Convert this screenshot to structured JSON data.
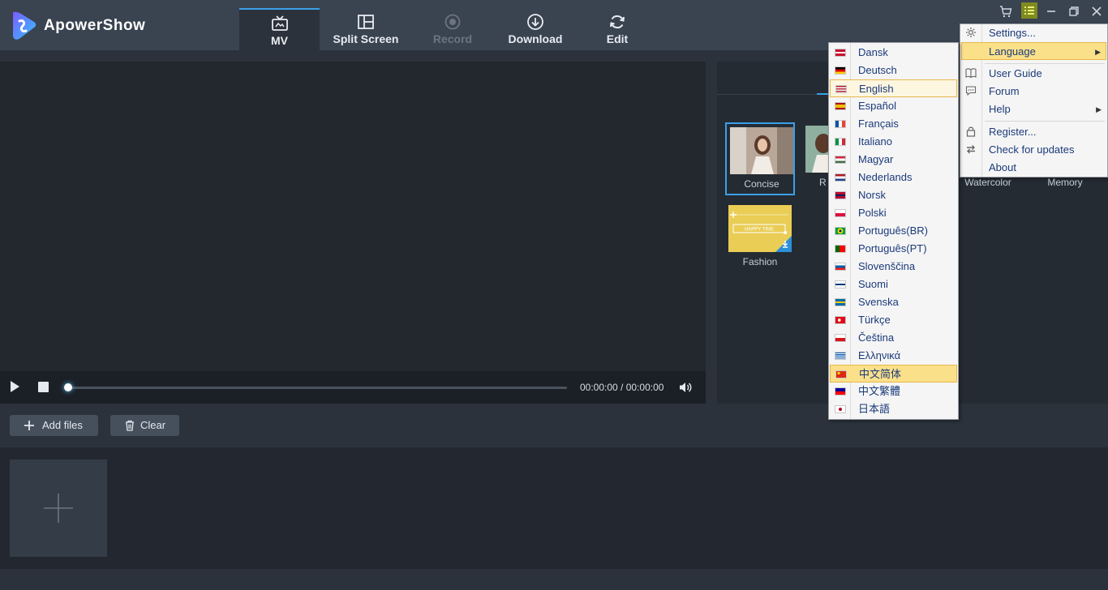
{
  "app": {
    "title": "ApowerShow",
    "logo_colors": [
      "#7b5cff",
      "#35c1ff"
    ]
  },
  "tabs": [
    {
      "label": "MV",
      "icon": "tv-icon",
      "active": true
    },
    {
      "label": "Split Screen",
      "icon": "split-screen-icon"
    },
    {
      "label": "Record",
      "icon": "record-icon",
      "disabled": true
    },
    {
      "label": "Download",
      "icon": "download-icon"
    },
    {
      "label": "Edit",
      "icon": "refresh-icon"
    }
  ],
  "window_controls": {
    "cart": "cart-icon",
    "menu": "menu-icon",
    "minimize": "minimize-icon",
    "restore": "restore-icon",
    "close": "close-icon"
  },
  "player": {
    "time": "00:00:00 / 00:00:00",
    "progress": 0
  },
  "themes": [
    {
      "label": "Concise",
      "selected": true
    },
    {
      "label": "R"
    },
    {
      "label": "Watercolor"
    },
    {
      "label": "Memory"
    },
    {
      "label": "Fashion",
      "thumb_text": "HAPPY TIME"
    }
  ],
  "toolbar": {
    "add_files": "Add files",
    "clear": "Clear"
  },
  "main_menu": {
    "items": [
      {
        "label": "Settings...",
        "icon": "gear-icon"
      },
      {
        "label": "Language",
        "submenu": true,
        "highlighted": true
      },
      {
        "label": "User Guide",
        "icon": "book-icon"
      },
      {
        "label": "Forum",
        "icon": "chat-icon"
      },
      {
        "label": "Help",
        "submenu": true
      },
      {
        "label": "Register...",
        "icon": "lock-icon"
      },
      {
        "label": "Check for updates",
        "icon": "update-icon"
      },
      {
        "label": "About"
      }
    ]
  },
  "language_menu": {
    "items": [
      {
        "label": "Dansk",
        "flag": "dk"
      },
      {
        "label": "Deutsch",
        "flag": "de"
      },
      {
        "label": "English",
        "flag": "us",
        "selected": true
      },
      {
        "label": "Español",
        "flag": "es"
      },
      {
        "label": "Français",
        "flag": "fr"
      },
      {
        "label": "Italiano",
        "flag": "it"
      },
      {
        "label": "Magyar",
        "flag": "hu"
      },
      {
        "label": "Nederlands",
        "flag": "nl"
      },
      {
        "label": "Norsk",
        "flag": "no"
      },
      {
        "label": "Polski",
        "flag": "pl"
      },
      {
        "label": "Português(BR)",
        "flag": "br"
      },
      {
        "label": "Português(PT)",
        "flag": "pt"
      },
      {
        "label": "Slovenščina",
        "flag": "si"
      },
      {
        "label": "Suomi",
        "flag": "fi"
      },
      {
        "label": "Svenska",
        "flag": "se"
      },
      {
        "label": "Türkçe",
        "flag": "tr"
      },
      {
        "label": "Čeština",
        "flag": "cz"
      },
      {
        "label": "Ελληνικά",
        "flag": "gr"
      },
      {
        "label": "中文简体",
        "flag": "cn",
        "highlighted": true
      },
      {
        "label": "中文繁體",
        "flag": "tw"
      },
      {
        "label": "日本語",
        "flag": "jp"
      }
    ]
  },
  "colors": {
    "accent": "#3aa0e8",
    "menu_highlight": "#fbe08a",
    "menu_text": "#1a3a7a"
  }
}
